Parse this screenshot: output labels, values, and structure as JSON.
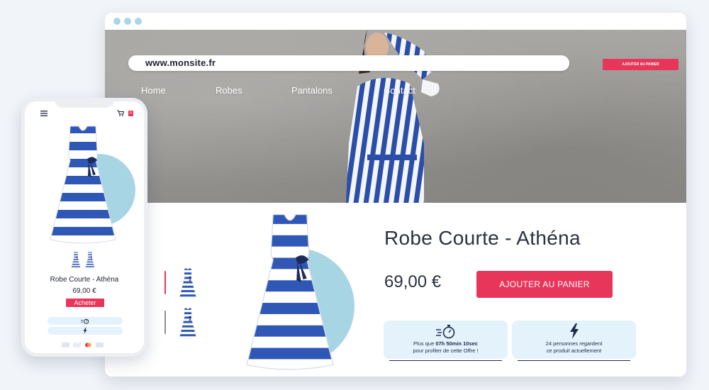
{
  "site": {
    "url": "www.monsite.fr",
    "header_cart_label": "AJOUTER AU PANIER",
    "nav": [
      "Home",
      "Robes",
      "Pantalons",
      "Contact"
    ]
  },
  "product": {
    "title": "Robe Courte - Athéna",
    "price": "69,00 €",
    "add_to_cart": "AJOUTER AU PANIER"
  },
  "offer_card": {
    "line1_prefix": "Plus que ",
    "countdown": "07h 50min 10sec",
    "line2": "pour profiter de cette Offre !",
    "icon": "stopwatch-icon"
  },
  "viewers_card": {
    "line1": "24 personnes regardent",
    "line2": "ce produit actuellement",
    "icon": "lightning-icon"
  },
  "mobile": {
    "title": "Robe Courte - Athéna",
    "price": "69,00 €",
    "buy_label": "Acheter",
    "cart_count": "0",
    "payment_icons": [
      "card-icon",
      "visa-icon",
      "mastercard-icon",
      "paypal-icon"
    ]
  },
  "colors": {
    "accent": "#e8355a",
    "info_bg": "#e4f2fb",
    "circle": "#a8d5e4",
    "text": "#2a3140",
    "stripe_blue": "#2f57b5"
  }
}
